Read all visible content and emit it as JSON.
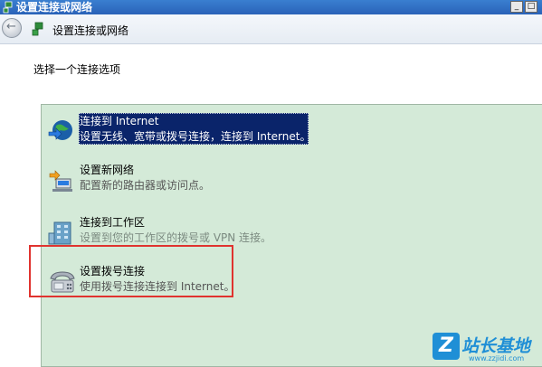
{
  "window": {
    "title": "设置连接或网络",
    "minimize": "_",
    "maximize": "□",
    "close": "x"
  },
  "nav": {
    "back": "←",
    "title": "设置连接或网络"
  },
  "prompt": "选择一个连接选项",
  "options": [
    {
      "title": "连接到 Internet",
      "desc": "设置无线、宽带或拨号连接，连接到 Internet。",
      "icon": "globe-icon",
      "selected": true
    },
    {
      "title": "设置新网络",
      "desc": "配置新的路由器或访问点。",
      "icon": "router-icon",
      "selected": false
    },
    {
      "title": "连接到工作区",
      "desc": "设置到您的工作区的拨号或 VPN 连接。",
      "icon": "building-icon",
      "selected": false
    },
    {
      "title": "设置拨号连接",
      "desc": "使用拨号连接连接到 Internet。",
      "icon": "phone-icon",
      "selected": false
    }
  ],
  "watermark": {
    "logo": "Z",
    "text": "站长基地",
    "url": "www.zzjidi.com"
  },
  "colors": {
    "titlebar": "#2a62b8",
    "list_background": "#d4ead8",
    "selection": "#0a246a",
    "highlight_box": "#e0332f",
    "watermark": "#1f8fd6"
  }
}
